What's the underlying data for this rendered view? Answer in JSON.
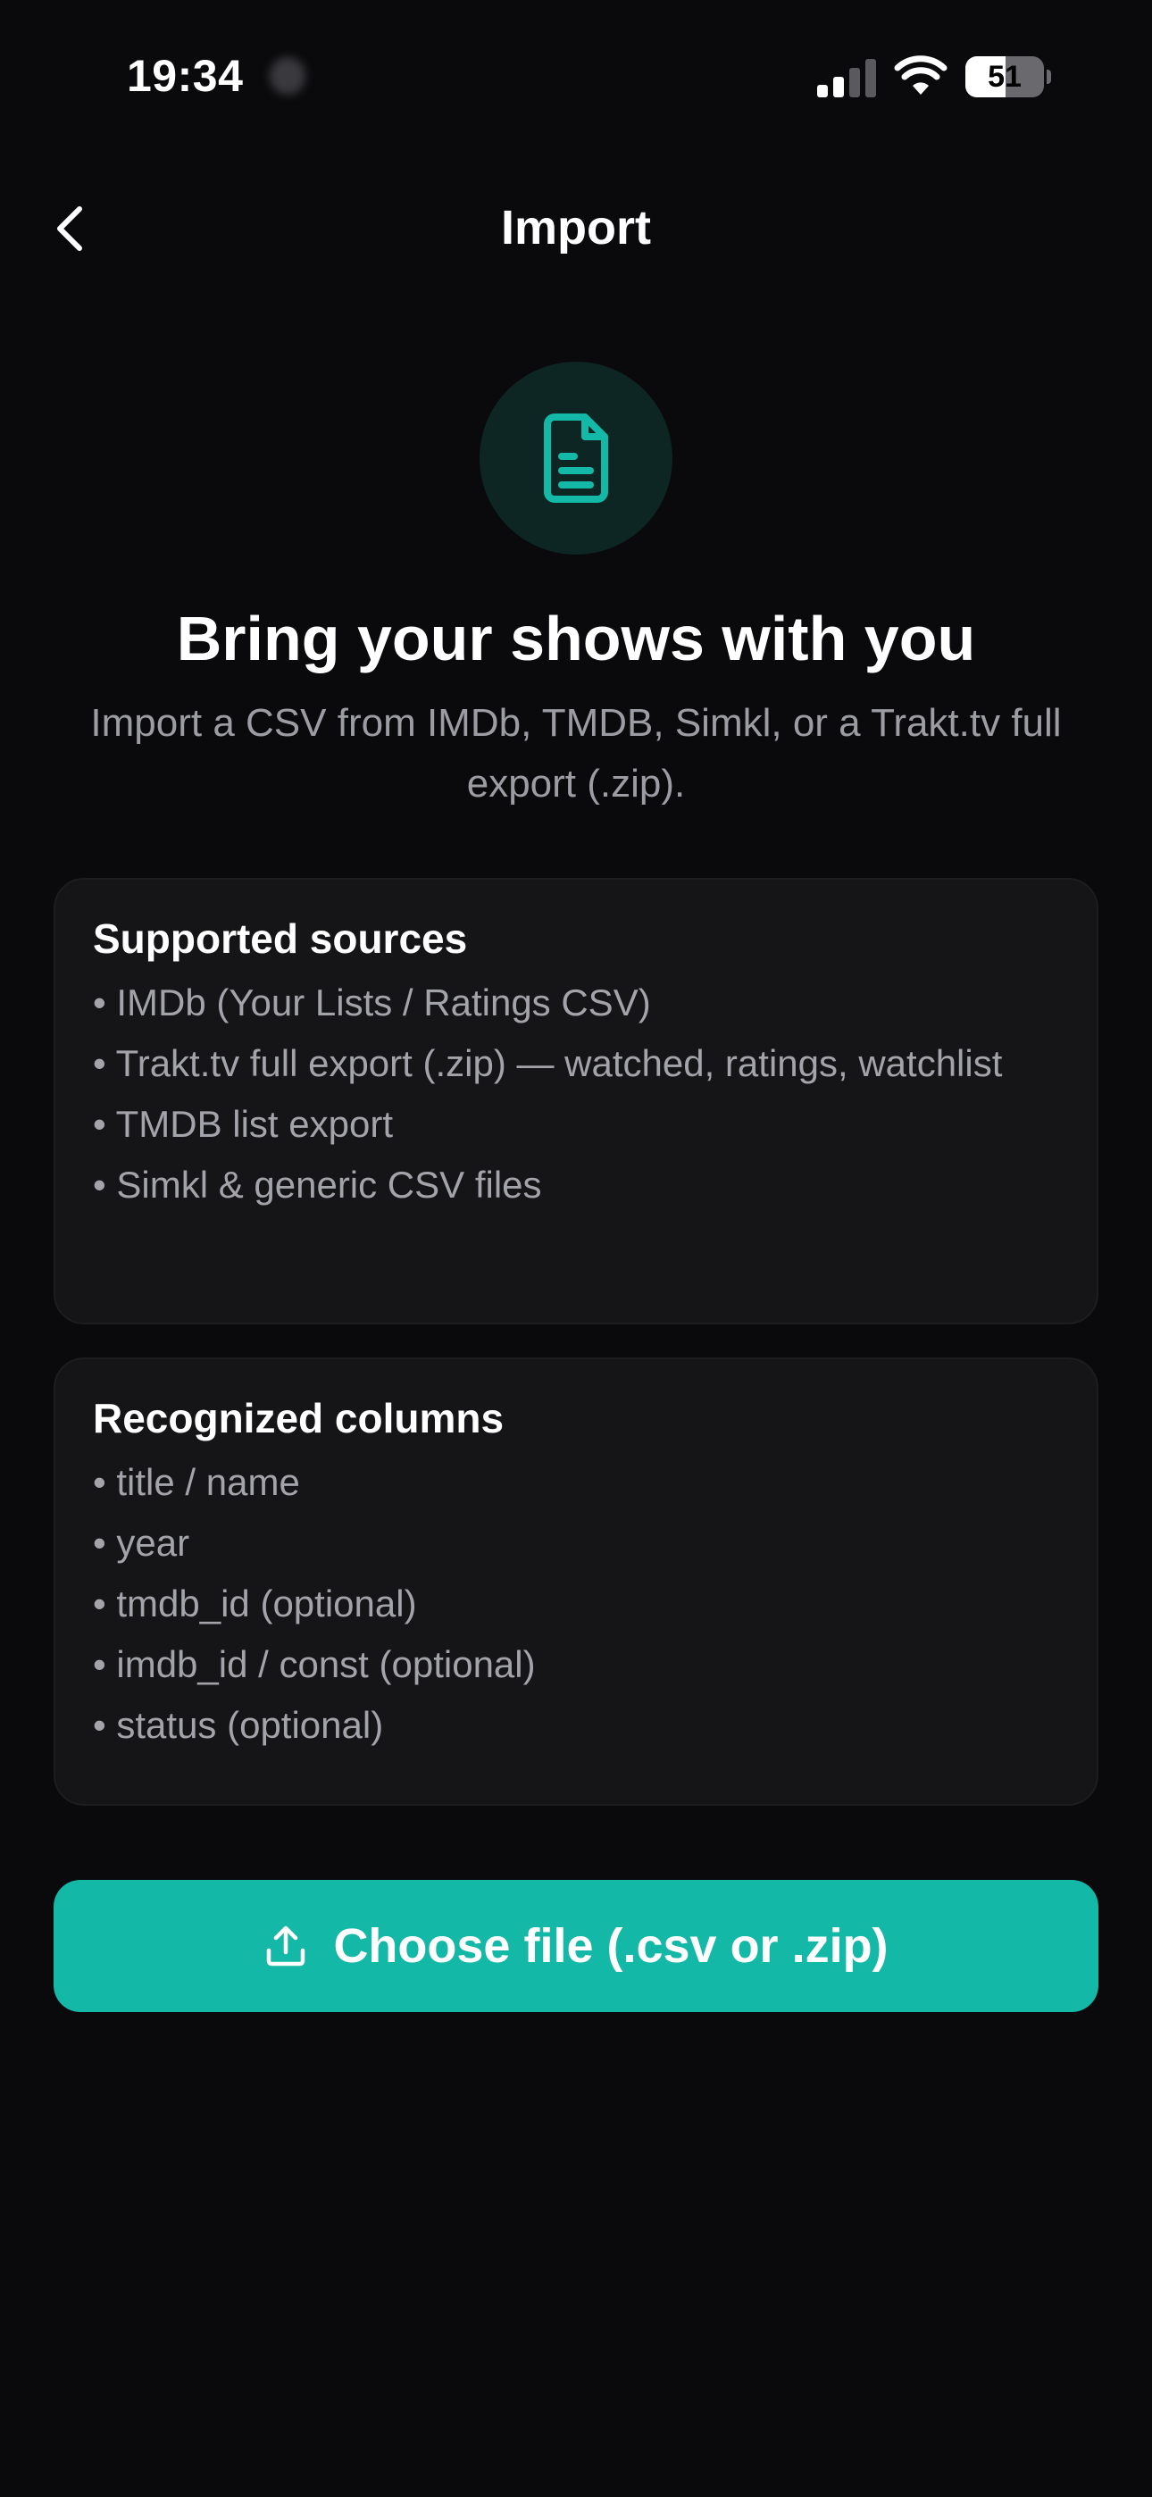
{
  "status_bar": {
    "time": "19:34",
    "battery_level": "51",
    "battery_fraction": 0.51
  },
  "nav": {
    "back_icon": "chevron-left-icon",
    "title": "Import"
  },
  "hero": {
    "icon": "document-icon",
    "title": "Bring your shows with you",
    "subtitle": "Import a CSV from IMDb, TMDB, Simkl, or a Trakt.tv full export (.zip)."
  },
  "supported_sources": {
    "title": "Supported sources",
    "items": [
      "• IMDb (Your Lists / Ratings CSV)",
      "• Trakt.tv full export (.zip) — watched, ratings, watchlist",
      "• TMDB list export",
      "• Simkl & generic CSV files"
    ]
  },
  "recognized_columns": {
    "title": "Recognized columns",
    "items": [
      "• title / name",
      "• year",
      "• tmdb_id (optional)",
      "• imdb_id / const (optional)",
      "• status (optional)"
    ]
  },
  "choose_file": {
    "icon": "upload-icon",
    "label": "Choose file (.csv or .zip)"
  },
  "colors": {
    "background": "#0a0a0c",
    "card": "#151517",
    "accent": "#14b8a6",
    "icon_circle": "#0d2523",
    "muted_text": "#a3a3aa"
  }
}
